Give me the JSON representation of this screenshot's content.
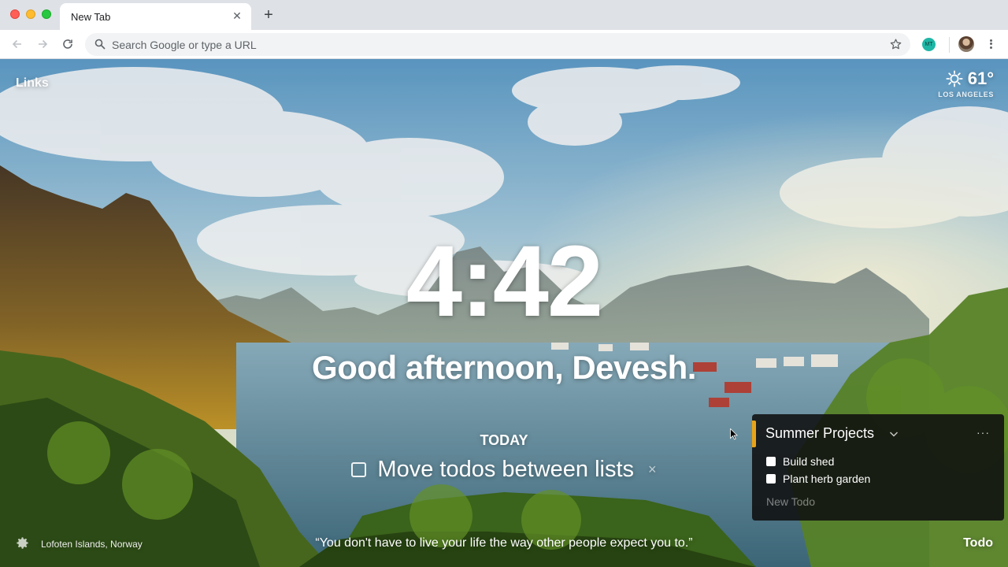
{
  "browser": {
    "tab_title": "New Tab",
    "tab_close_icon": "close-icon",
    "new_tab_label": "+",
    "omnibox_placeholder": "Search Google or type a URL",
    "extension_badge": "MT"
  },
  "dashboard": {
    "links_label": "Links",
    "weather": {
      "temperature": "61°",
      "location": "LOS ANGELES",
      "icon": "sun-icon"
    },
    "clock": "4:42",
    "greeting": "Good afternoon, Devesh.",
    "focus": {
      "heading": "TODAY",
      "text": "Move todos between lists",
      "delete_label": "×"
    },
    "photo_location": "Lofoten Islands, Norway",
    "quote": "“You don't have to live your life the way other people expect you to.”",
    "todo_toggle": "Todo"
  },
  "todo_panel": {
    "list_title": "Summer Projects",
    "more_label": "···",
    "items": [
      {
        "label": "Build shed",
        "done": false
      },
      {
        "label": "Plant herb garden",
        "done": false
      }
    ],
    "new_todo_placeholder": "New Todo",
    "accent_color": "#e8a317"
  }
}
